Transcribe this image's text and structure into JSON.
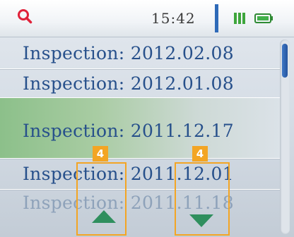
{
  "status": {
    "time": "15:42"
  },
  "icons": {
    "search": "search-icon",
    "signal": "signal-icon",
    "battery": "battery-icon",
    "scroll_up": "arrow-up-icon",
    "scroll_down": "arrow-down-icon"
  },
  "list": {
    "items": [
      {
        "label": "Inspection: 2012.02.08"
      },
      {
        "label": "Inspection: 2012.01.08"
      },
      {
        "label": "Inspection: 2011.12.17"
      },
      {
        "label": "Inspection: 2011.12.01"
      },
      {
        "label": "Inspection: 2011.11.18"
      }
    ],
    "selected_index": 2
  },
  "annotations": [
    {
      "number": "4"
    },
    {
      "number": "4"
    }
  ],
  "colors": {
    "accent": "#2e6ab8",
    "text": "#27508b",
    "selected": "#8cc08a",
    "annotation": "#f3a524",
    "arrow": "#2f8f5e"
  }
}
